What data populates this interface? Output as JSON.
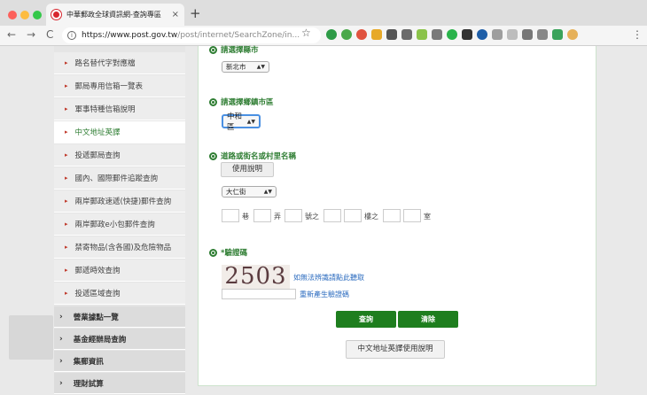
{
  "browser": {
    "tab_title": "中華郵政全球資訊網-查詢專區",
    "tab_close": "×",
    "new_tab": "+",
    "url_host": "https://www.post.gov.tw",
    "url_path": "/post/internet/SearchZone/in...",
    "back": "←",
    "forward": "→",
    "reload": "C",
    "star": "☆",
    "menu": "⋮"
  },
  "sidebar": {
    "items": [
      {
        "label": "路名替代字對應檔"
      },
      {
        "label": "郵局專用信箱一覽表"
      },
      {
        "label": "軍事特種信箱說明"
      },
      {
        "label": "中文地址英譯"
      },
      {
        "label": "投遞郵局查詢"
      },
      {
        "label": "國內、國際郵件追蹤查詢"
      },
      {
        "label": "兩岸郵政速遞(快捷)郵件查詢"
      },
      {
        "label": "兩岸郵政e小包郵件查詢"
      },
      {
        "label": "禁寄物品(含各國)及危險物品"
      },
      {
        "label": "郵遞時效查詢"
      },
      {
        "label": "投遞區域查詢"
      }
    ],
    "categories": [
      {
        "label": "營業據點一覽"
      },
      {
        "label": "基金經辦局查詢"
      },
      {
        "label": "集郵資訊"
      },
      {
        "label": "理財試算"
      }
    ]
  },
  "form": {
    "city": {
      "heading": "請選擇縣市",
      "value": "新北市"
    },
    "district": {
      "heading": "請選擇鄉鎮市區",
      "value": "中和區"
    },
    "road": {
      "heading": "道路或街名或村里名稱",
      "help_button": "使用說明",
      "value": "大仁街"
    },
    "address_labels": {
      "lane": "巷",
      "alley": "弄",
      "number": "號之",
      "floor": "樓之",
      "room": "室"
    },
    "captcha": {
      "heading": "*驗證碼",
      "code": "2503",
      "audio_link": "如無法辨識請點此聽取",
      "refresh_link": "重新產生驗證碼"
    },
    "buttons": {
      "search": "查詢",
      "clear": "清除",
      "guide": "中文地址英譯使用說明"
    }
  }
}
